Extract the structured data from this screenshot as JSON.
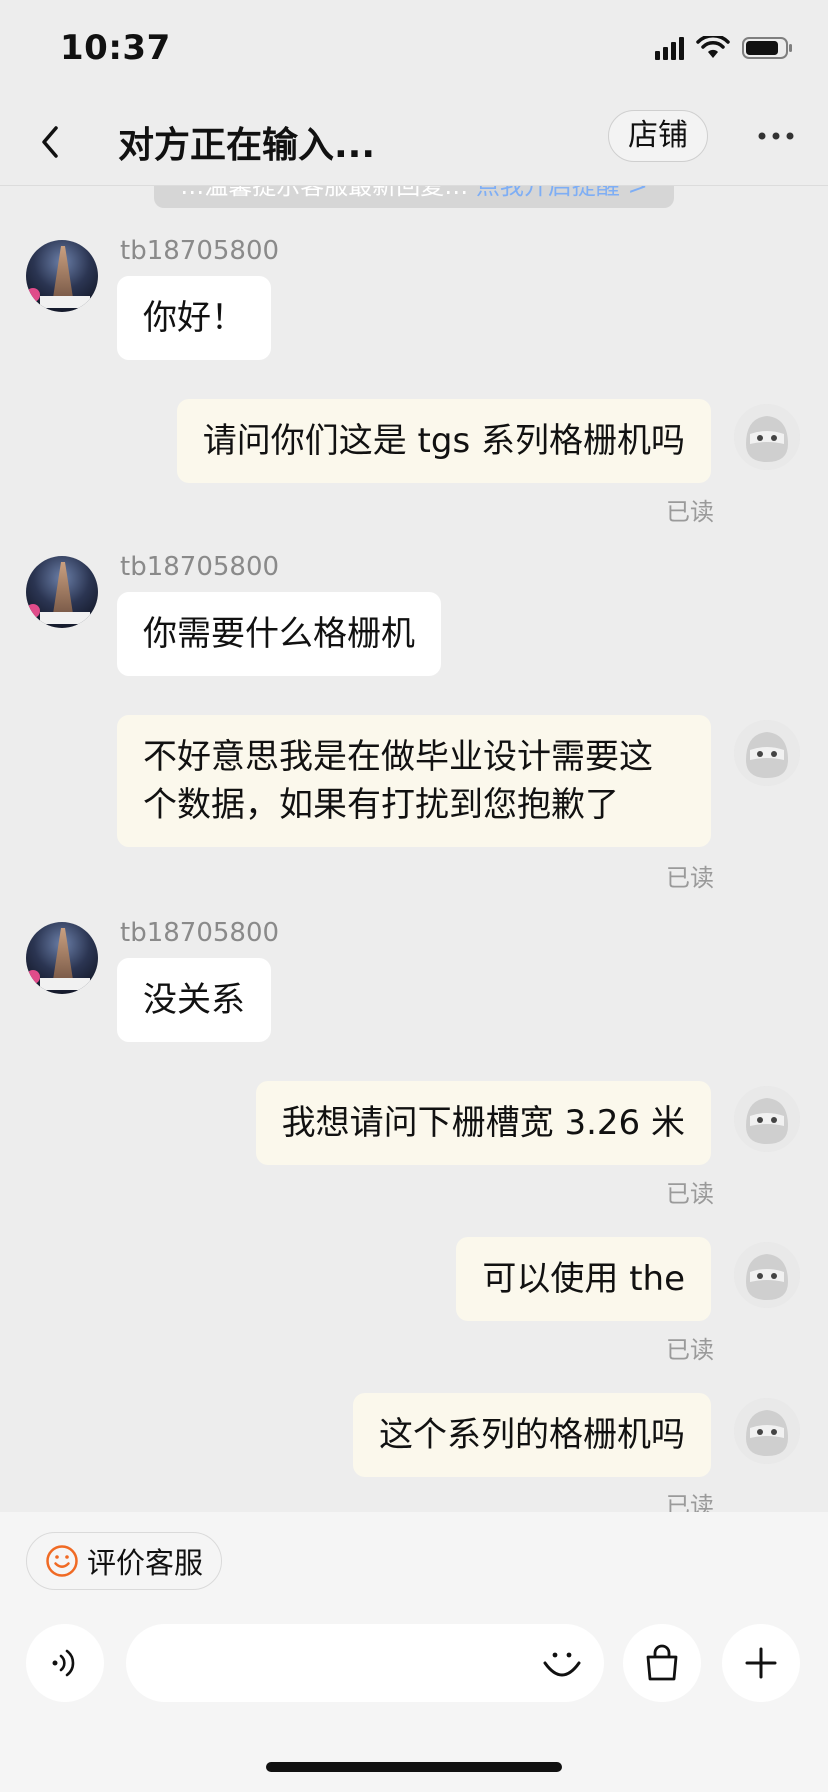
{
  "status_bar": {
    "time": "10:37"
  },
  "header": {
    "title": "对方正在输入...",
    "shop_label": "店铺"
  },
  "notice": {
    "text": "…温馨提示客服最新回复…",
    "link": "点我开启提醒 >"
  },
  "messages": [
    {
      "side": "in",
      "sender": "tb18705800",
      "text": "你好！"
    },
    {
      "side": "out",
      "text": "请问你们这是 tgs 系列格栅机吗",
      "status": "已读"
    },
    {
      "side": "in",
      "sender": "tb18705800",
      "text": "你需要什么格栅机"
    },
    {
      "side": "out",
      "text_line1": "不好意思我是在做毕业设计需要这",
      "text_line2": "个数据，如果有打扰到您抱歉了",
      "status": "已读"
    },
    {
      "side": "in",
      "sender": "tb18705800",
      "text": "没关系"
    },
    {
      "side": "out",
      "text": "我想请问下栅槽宽 3.26 米",
      "status": "已读"
    },
    {
      "side": "out",
      "text": "可以使用 the",
      "status": "已读"
    },
    {
      "side": "out",
      "text": "这个系列的格栅机吗",
      "status": "已读"
    }
  ],
  "bottom": {
    "rate_label": "评价客服",
    "input_value": ""
  },
  "colors": {
    "background": "#ededed",
    "incoming_bubble": "#ffffff",
    "outgoing_bubble": "#fbf8ec",
    "accent_orange": "#f06a24"
  }
}
